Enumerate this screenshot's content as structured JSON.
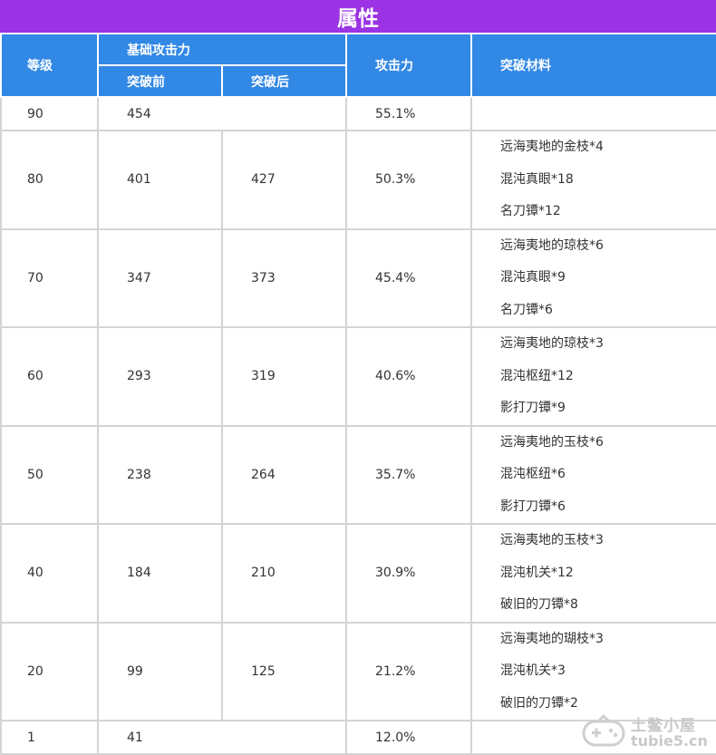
{
  "title": "属性",
  "headers": {
    "level": "等级",
    "base_attack": "基础攻击力",
    "before": "突破前",
    "after": "突破后",
    "attack": "攻击力",
    "materials": "突破材料"
  },
  "rows": [
    {
      "level": "90",
      "before": "454",
      "after": "",
      "attack": "55.1%",
      "materials": []
    },
    {
      "level": "80",
      "before": "401",
      "after": "427",
      "attack": "50.3%",
      "materials": [
        "远海夷地的金枝*4",
        "混沌真眼*18",
        "名刀镡*12"
      ]
    },
    {
      "level": "70",
      "before": "347",
      "after": "373",
      "attack": "45.4%",
      "materials": [
        "远海夷地的琼枝*6",
        "混沌真眼*9",
        "名刀镡*6"
      ]
    },
    {
      "level": "60",
      "before": "293",
      "after": "319",
      "attack": "40.6%",
      "materials": [
        "远海夷地的琼枝*3",
        "混沌枢纽*12",
        "影打刀镡*9"
      ]
    },
    {
      "level": "50",
      "before": "238",
      "after": "264",
      "attack": "35.7%",
      "materials": [
        "远海夷地的玉枝*6",
        "混沌枢纽*6",
        "影打刀镡*6"
      ]
    },
    {
      "level": "40",
      "before": "184",
      "after": "210",
      "attack": "30.9%",
      "materials": [
        "远海夷地的玉枝*3",
        "混沌机关*12",
        "破旧的刀镡*8"
      ]
    },
    {
      "level": "20",
      "before": "99",
      "after": "125",
      "attack": "21.2%",
      "materials": [
        "远海夷地的瑚枝*3",
        "混沌机关*3",
        "破旧的刀镡*2"
      ]
    },
    {
      "level": "1",
      "before": "41",
      "after": "",
      "attack": "12.0%",
      "materials": []
    }
  ],
  "watermark": {
    "cn": "土鳖小屋",
    "en": "tubie5.cn"
  }
}
